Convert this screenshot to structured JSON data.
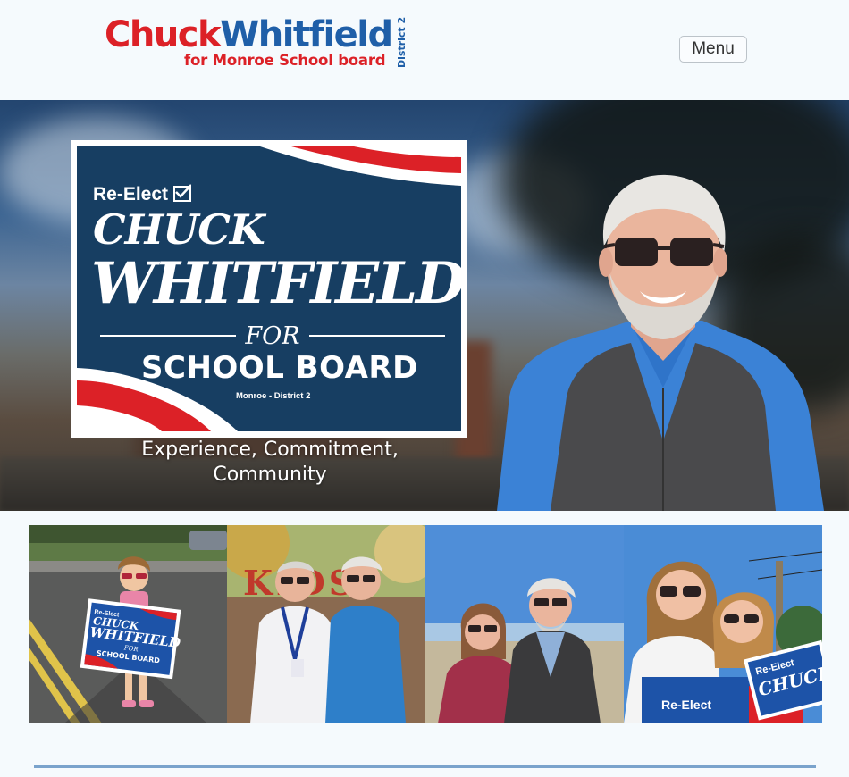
{
  "header": {
    "logo": {
      "first_name": "Chuck",
      "last_name": "Whitfield",
      "subtitle": "for Monroe School board",
      "district": "District 2"
    },
    "menu_label": "Menu"
  },
  "hero": {
    "sign": {
      "re_elect": "Re-Elect",
      "first_name": "CHUCK",
      "last_name": "WHITFIELD",
      "for": "FOR",
      "school_board": "SCHOOL BOARD",
      "district": "Monroe - District 2"
    },
    "tagline": "Experience, Commitment, Community"
  },
  "gallery": {
    "photo1_sign": {
      "re_elect": "Re-Elect",
      "first": "CHUCK",
      "last": "WHITFIELD",
      "for": "FOR",
      "board": "SCHOOL BOARD"
    },
    "photo2_banner": "KIDS",
    "photo4_sign": {
      "re_elect": "Re-Elect",
      "first": "CHUCK"
    }
  },
  "colors": {
    "brand_red": "#dc2127",
    "brand_blue": "#1f5fa8",
    "sign_navy": "#173e62",
    "divider": "#7aa3cc"
  }
}
